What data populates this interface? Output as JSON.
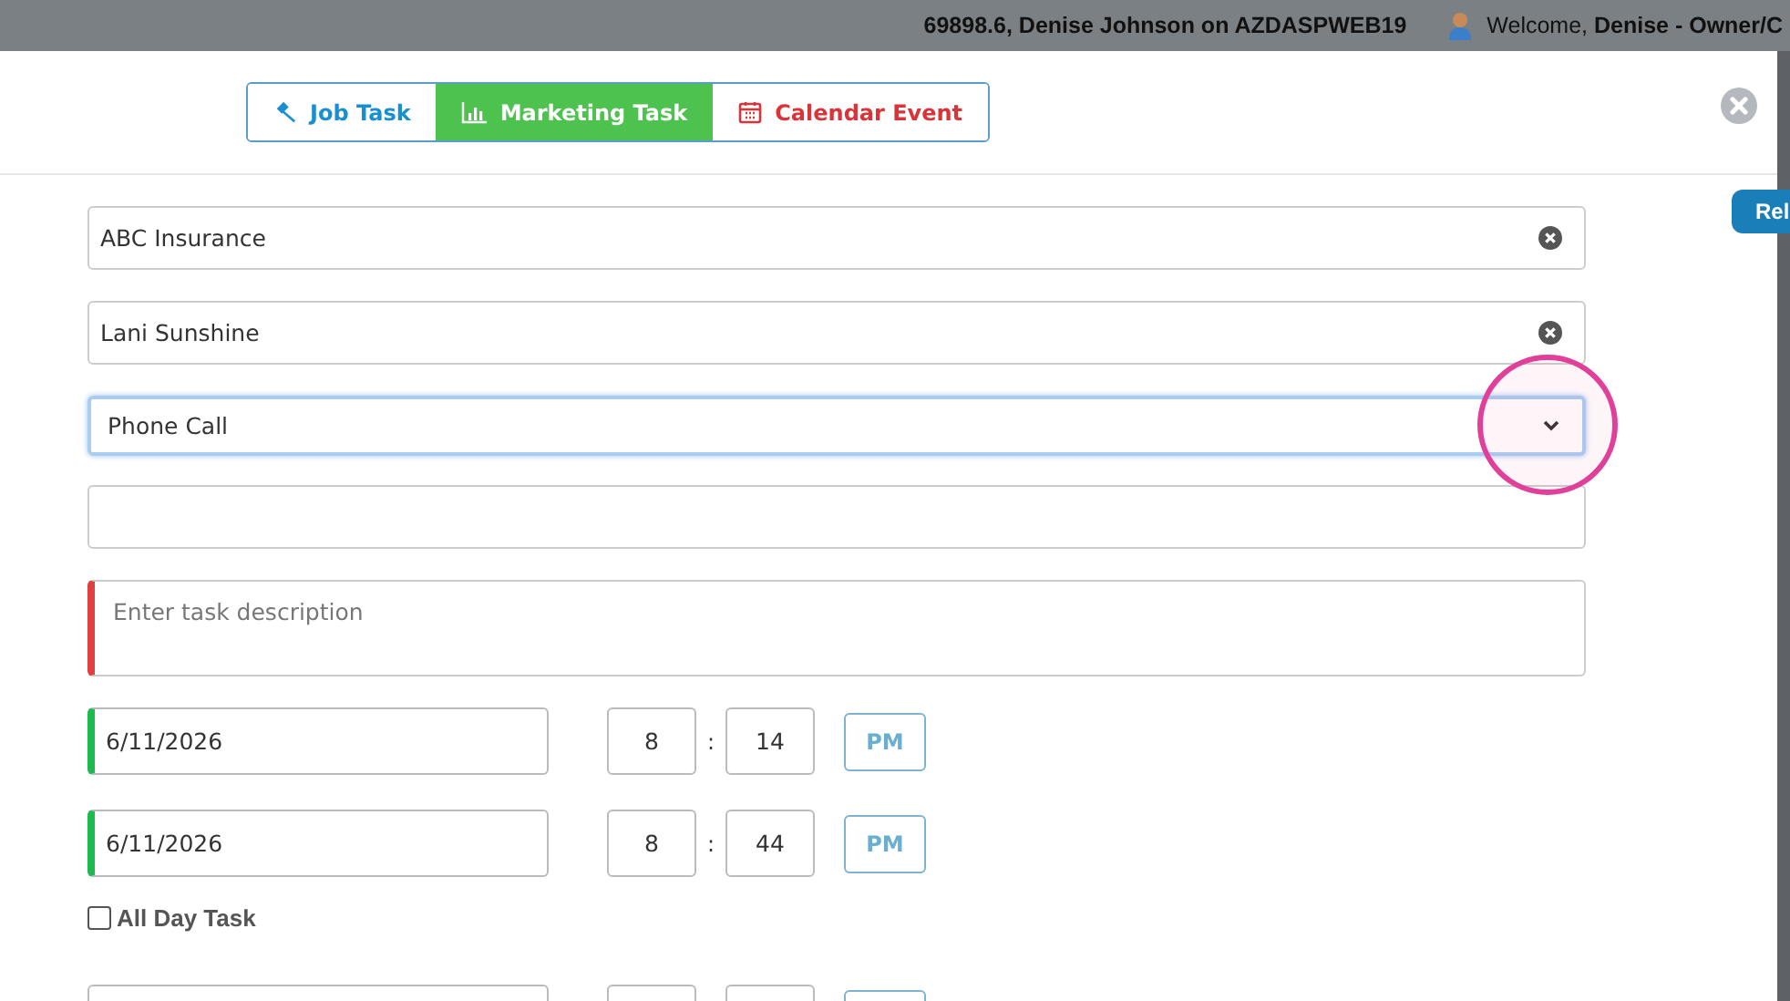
{
  "header": {
    "session": "69898.6, Denise Johnson on AZDASPWEB19",
    "welcome": "Welcome, **Denise - Owner/C**"
  },
  "tabs": [
    {
      "label": "Job Task",
      "kind": "job",
      "color": "#1a8fd0",
      "selected": false
    },
    {
      "label": "Marketing Task",
      "kind": "marketing",
      "color": "#4ec24e",
      "selected": true
    },
    {
      "label": "Calendar Event",
      "kind": "calendar",
      "color": "#d9343a",
      "selected": false
    }
  ],
  "fields": [
    {
      "kind": "text",
      "value": "ABC Insurance",
      "clearable": true
    },
    {
      "kind": "text",
      "value": "Lani Sunshine",
      "clearable": true
    },
    {
      "kind": "select",
      "value": "Phone Call",
      "focused": true
    },
    {
      "kind": "text",
      "clearable": false
    },
    {
      "kind": "textarea",
      "placeholder": "Enter task description",
      "required": true
    }
  ],
  "schedule": [
    {
      "date": "6/11/2026",
      "hour": "8",
      "minute": "14",
      "separator": ":",
      "ampm": "PM",
      "valid": true
    },
    {
      "date": "6/11/2026",
      "hour": "8",
      "minute": "44",
      "separator": ":",
      "ampm": "PM",
      "valid": true
    }
  ],
  "all_day": {
    "label": "All Day Task",
    "checked": false
  },
  "side_button": {
    "label": "Rel"
  },
  "annotation": {
    "highlight": true
  }
}
